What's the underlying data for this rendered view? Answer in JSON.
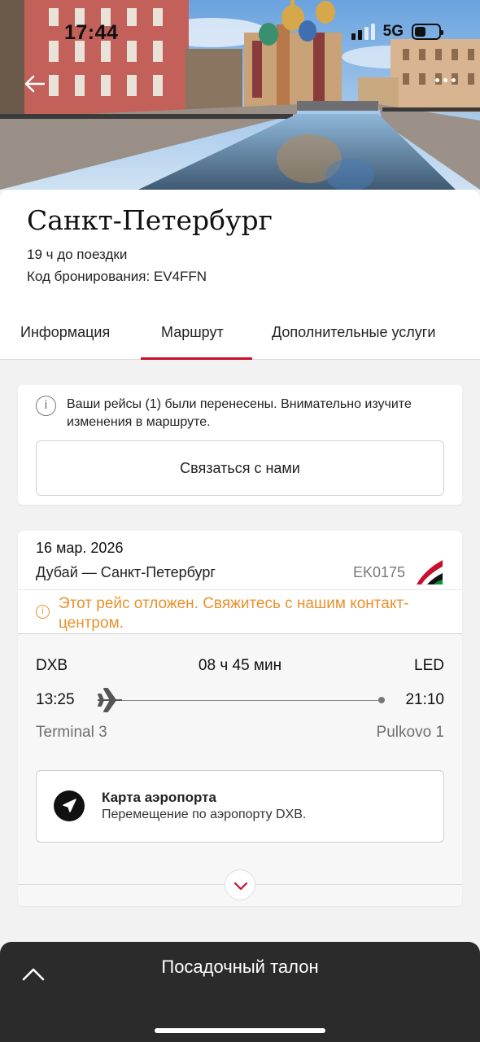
{
  "status_bar": {
    "time": "17:44",
    "network": "5G"
  },
  "trip": {
    "city": "Санкт-Петербург",
    "time_until": "19 ч до поездки",
    "booking_code": "Код бронирования: EV4FFN"
  },
  "tabs": [
    {
      "label": "Информация",
      "active": false
    },
    {
      "label": "Маршрут",
      "active": true
    },
    {
      "label": "Дополнительные услуги",
      "active": false
    }
  ],
  "notice": {
    "text": "Ваши рейсы (1) были перенесены. Внимательно изучите изменения в маршруте.",
    "button": "Связаться с нами"
  },
  "flight": {
    "date": "16 мар. 2026",
    "route": "Дубай — Санкт-Петербург",
    "number": "EK0175",
    "warning": "Этот рейс отложен. Свяжитесь с нашим контакт-центром.",
    "from_code": "DXB",
    "to_code": "LED",
    "duration": "08 ч 45 мин",
    "departure_time": "13:25",
    "arrival_time": "21:10",
    "departure_terminal": "Terminal 3",
    "arrival_terminal": "Pulkovo 1",
    "airport_map": {
      "title": "Карта аэропорта",
      "subtitle": "Перемещение по аэропорту DXB."
    }
  },
  "bottom_bar": {
    "title": "Посадочный талон"
  },
  "colors": {
    "accent": "#c8102e",
    "warning": "#e8912e",
    "bottom_bar": "#2b2b2b"
  }
}
